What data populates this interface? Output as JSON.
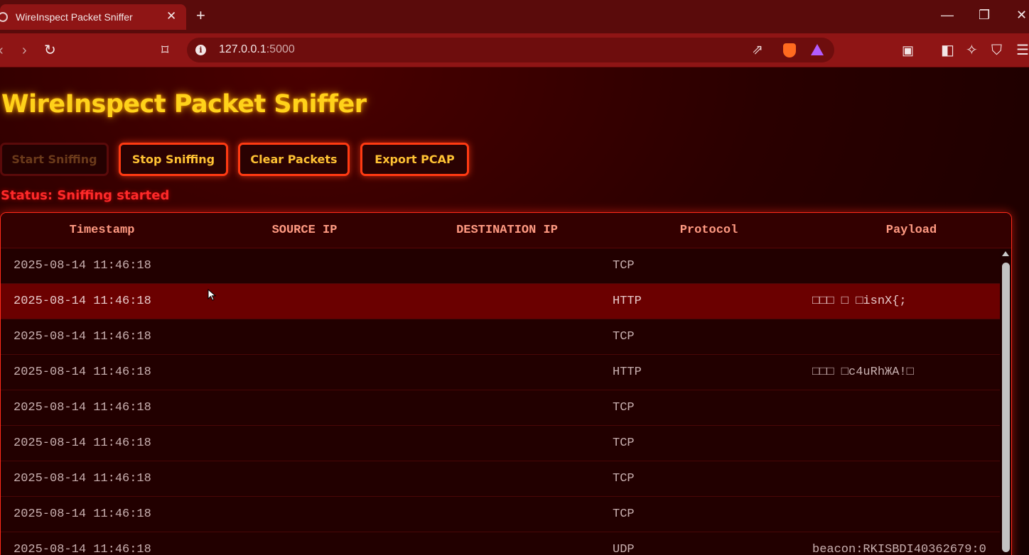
{
  "browser": {
    "tab_title": "WireInspect Packet Sniffer",
    "tab_close": "✕",
    "new_tab": "+",
    "url_host": "127.0.0.1",
    "url_port": ":5000",
    "window_buttons": {
      "minimize": "—",
      "restore": "❐",
      "close": "✕"
    }
  },
  "page": {
    "title": "WireInspect Packet Sniffer",
    "buttons": {
      "start": "Start Sniffing",
      "stop": "Stop Sniffing",
      "clear": "Clear Packets",
      "export": "Export PCAP"
    },
    "status": "Status: Sniffing started"
  },
  "table": {
    "headers": [
      "Timestamp",
      "SOURCE IP",
      "DESTINATION IP",
      "Protocol",
      "Payload"
    ],
    "rows": [
      {
        "timestamp": "2025-08-14 11:46:18",
        "src": "",
        "dst": "",
        "protocol": "TCP",
        "payload": ""
      },
      {
        "timestamp": "2025-08-14 11:46:18",
        "src": "",
        "dst": "",
        "protocol": "HTTP",
        "payload": "□□□ □ □isnX{;"
      },
      {
        "timestamp": "2025-08-14 11:46:18",
        "src": "",
        "dst": "",
        "protocol": "TCP",
        "payload": ""
      },
      {
        "timestamp": "2025-08-14 11:46:18",
        "src": "",
        "dst": "",
        "protocol": "HTTP",
        "payload": "□□□ □c4uRhЖA!□"
      },
      {
        "timestamp": "2025-08-14 11:46:18",
        "src": "",
        "dst": "",
        "protocol": "TCP",
        "payload": ""
      },
      {
        "timestamp": "2025-08-14 11:46:18",
        "src": "",
        "dst": "",
        "protocol": "TCP",
        "payload": ""
      },
      {
        "timestamp": "2025-08-14 11:46:18",
        "src": "",
        "dst": "",
        "protocol": "TCP",
        "payload": ""
      },
      {
        "timestamp": "2025-08-14 11:46:18",
        "src": "",
        "dst": "",
        "protocol": "TCP",
        "payload": ""
      },
      {
        "timestamp": "2025-08-14 11:46:18",
        "src": "",
        "dst": "",
        "protocol": "UDP",
        "payload": "beacon:RKISBDI40362679:0"
      }
    ],
    "highlighted_row": 1
  },
  "colors": {
    "accent": "#ff3a12",
    "title": "#ffd21a",
    "status": "#ff2a2a",
    "header_text": "#ff9a82"
  }
}
